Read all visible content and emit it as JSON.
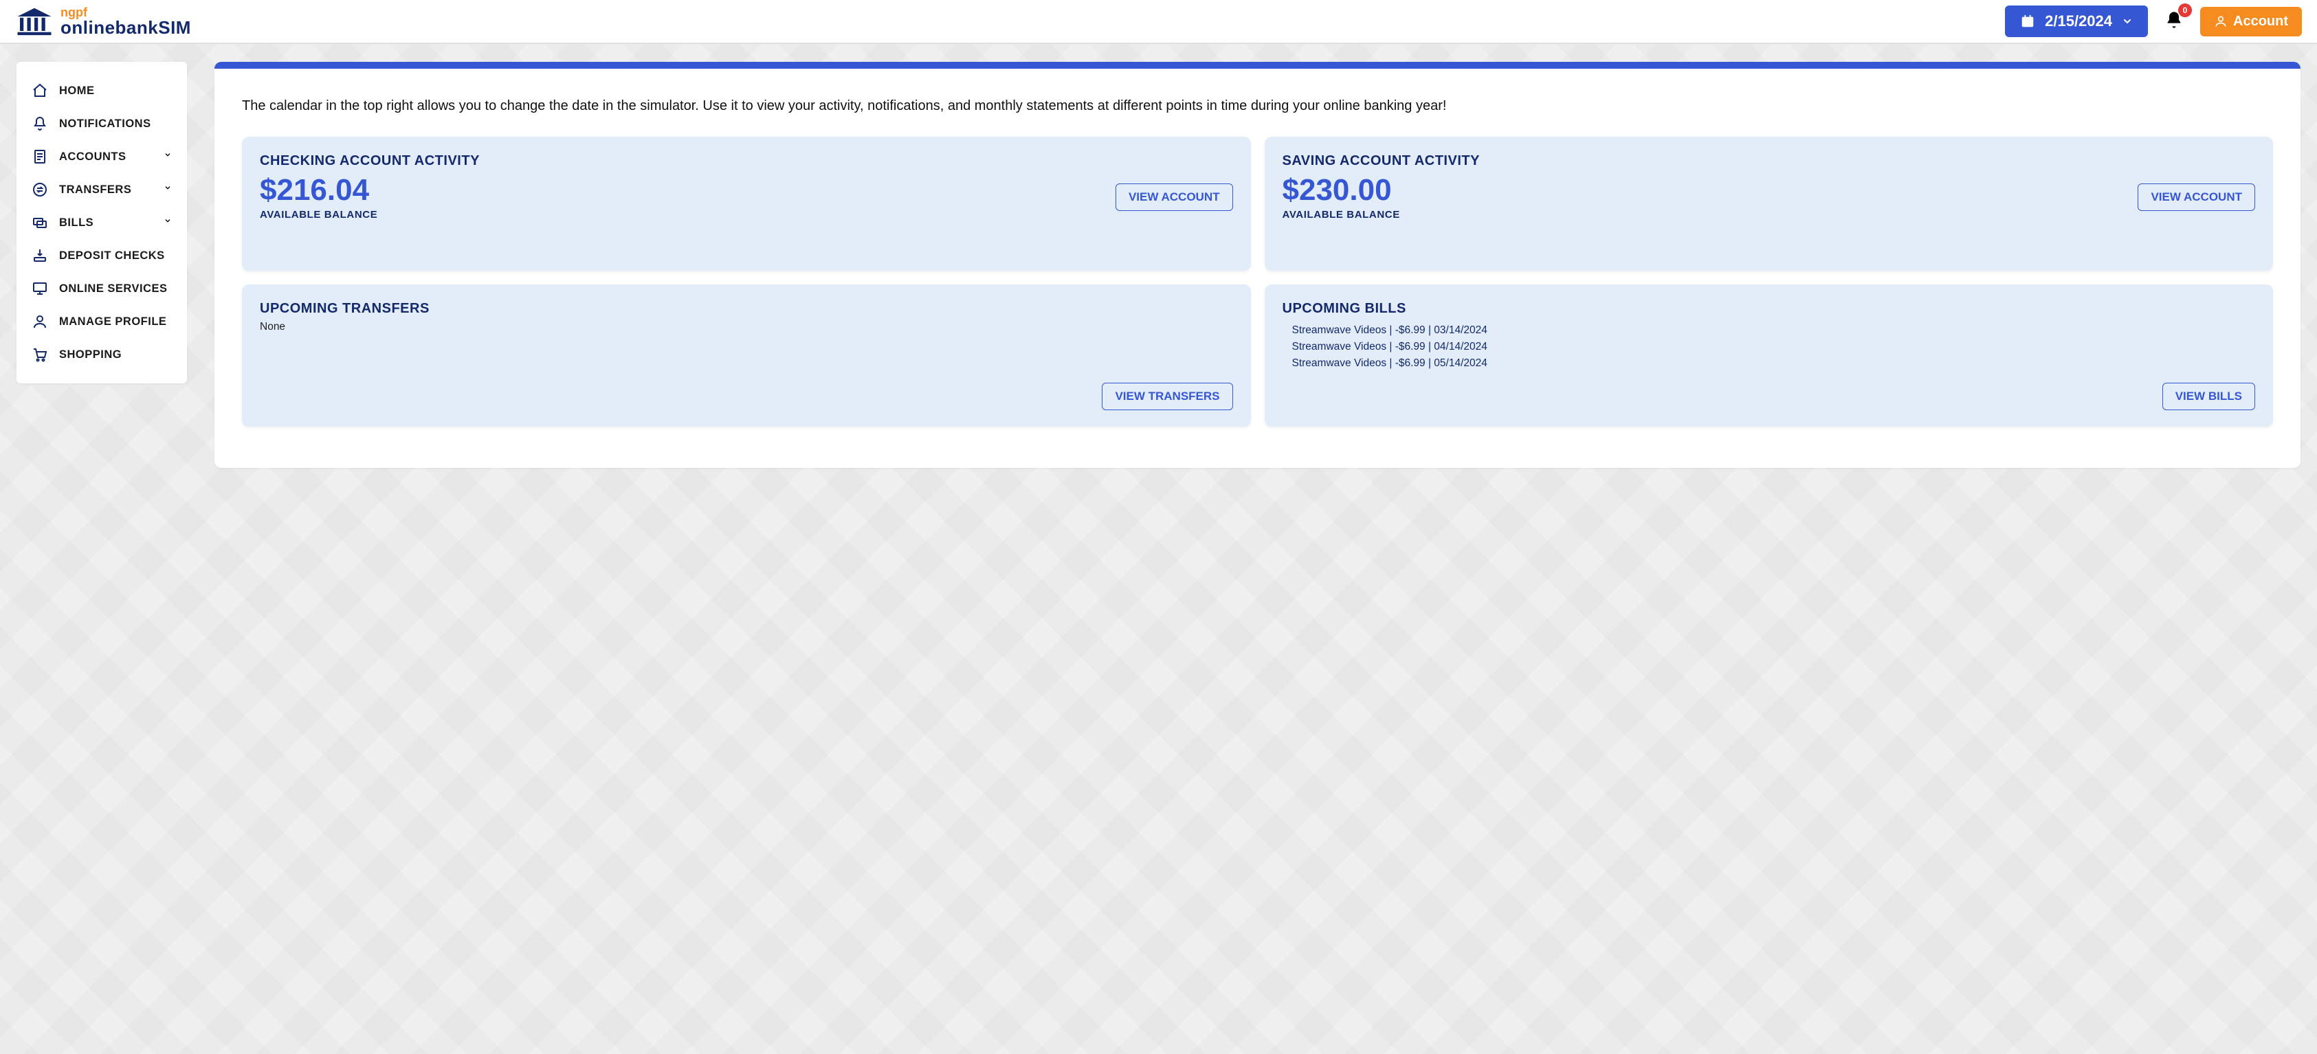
{
  "header": {
    "logo_top": "ngpf",
    "logo_bottom": "onlinebankSIM",
    "date": "2/15/2024",
    "notifications_count": "0",
    "account_label": "Account"
  },
  "sidebar": {
    "items": [
      {
        "label": "HOME",
        "icon": "home",
        "expandable": false
      },
      {
        "label": "NOTIFICATIONS",
        "icon": "bell",
        "expandable": false
      },
      {
        "label": "ACCOUNTS",
        "icon": "doc",
        "expandable": true
      },
      {
        "label": "TRANSFERS",
        "icon": "transfer",
        "expandable": true
      },
      {
        "label": "BILLS",
        "icon": "bills",
        "expandable": true
      },
      {
        "label": "DEPOSIT CHECKS",
        "icon": "deposit",
        "expandable": false
      },
      {
        "label": "ONLINE SERVICES",
        "icon": "monitor",
        "expandable": false
      },
      {
        "label": "MANAGE PROFILE",
        "icon": "profile",
        "expandable": false
      },
      {
        "label": "SHOPPING",
        "icon": "cart",
        "expandable": false
      }
    ]
  },
  "intro_text": "The calendar in the top right allows you to change the date in the simulator. Use it to view your activity, notifications, and monthly statements at different points in time during your online banking year!",
  "checking": {
    "title": "CHECKING ACCOUNT ACTIVITY",
    "balance": "$216.04",
    "sub": "AVAILABLE BALANCE",
    "button": "VIEW ACCOUNT"
  },
  "saving": {
    "title": "SAVING ACCOUNT ACTIVITY",
    "balance": "$230.00",
    "sub": "AVAILABLE BALANCE",
    "button": "VIEW ACCOUNT"
  },
  "transfers": {
    "title": "UPCOMING TRANSFERS",
    "empty": "None",
    "button": "VIEW TRANSFERS"
  },
  "bills": {
    "title": "UPCOMING BILLS",
    "items": [
      "Streamwave Videos | -$6.99 | 03/14/2024",
      "Streamwave Videos | -$6.99 | 04/14/2024",
      "Streamwave Videos | -$6.99 | 05/14/2024"
    ],
    "button": "VIEW BILLS"
  }
}
